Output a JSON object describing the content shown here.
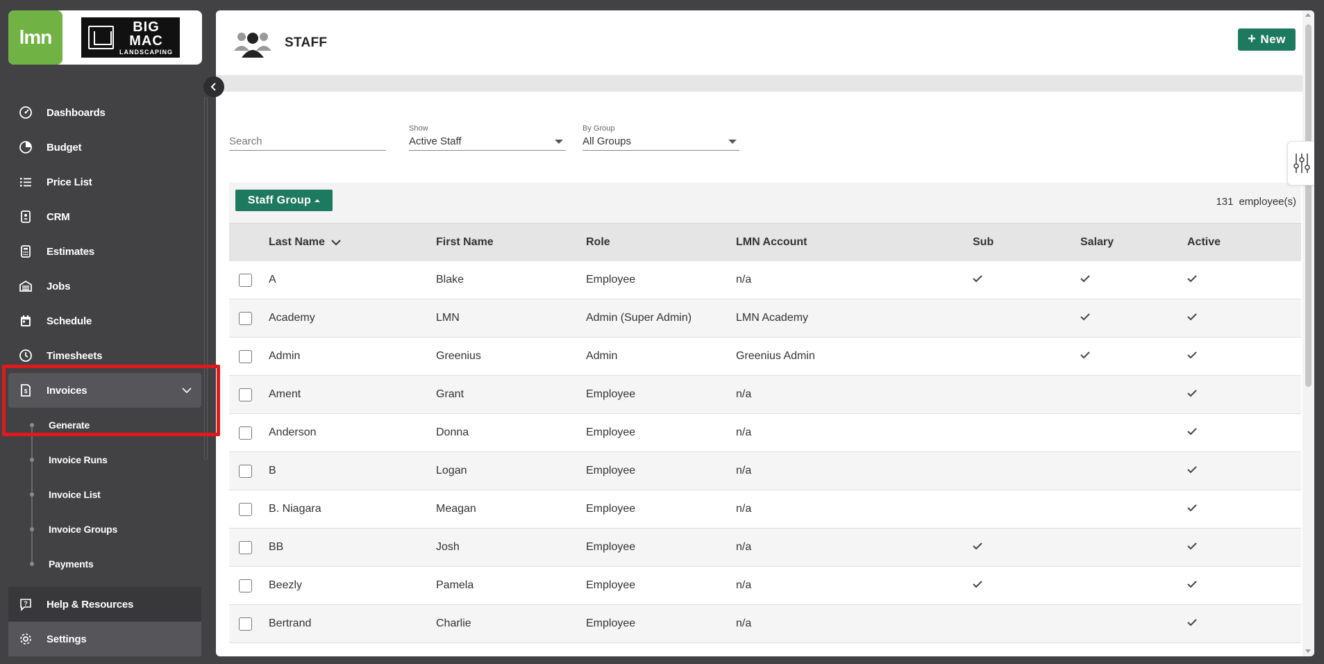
{
  "brand": {
    "lmn_logo": "lmn",
    "company_logo_line1": "BIG",
    "company_logo_line2": "MAC",
    "company_logo_line3": "LANDSCAPING"
  },
  "sidebar": {
    "items": [
      {
        "label": "Dashboards",
        "icon": "dashboard-icon"
      },
      {
        "label": "Budget",
        "icon": "pie-chart-icon"
      },
      {
        "label": "Price List",
        "icon": "list-icon"
      },
      {
        "label": "CRM",
        "icon": "contact-card-icon"
      },
      {
        "label": "Estimates",
        "icon": "calculator-icon"
      },
      {
        "label": "Jobs",
        "icon": "building-icon"
      },
      {
        "label": "Schedule",
        "icon": "calendar-icon"
      },
      {
        "label": "Timesheets",
        "icon": "clock-icon"
      },
      {
        "label": "Invoices",
        "icon": "invoice-icon"
      }
    ],
    "invoices_sub": [
      "Generate",
      "Invoice Runs",
      "Invoice List",
      "Invoice Groups",
      "Payments"
    ],
    "bottom": [
      {
        "label": "Help & Resources",
        "icon": "help-icon"
      },
      {
        "label": "Settings",
        "icon": "gear-icon"
      }
    ]
  },
  "header": {
    "title": "STAFF",
    "new_button": "New"
  },
  "filters": {
    "search_placeholder": "Search",
    "show_label": "Show",
    "show_value": "Active Staff",
    "group_label": "By Group",
    "group_value": "All Groups"
  },
  "table": {
    "group_button": "Staff Group",
    "employee_count": "131",
    "employee_count_suffix": "employee(s)",
    "columns": [
      "Last Name",
      "First Name",
      "Role",
      "LMN Account",
      "Sub",
      "Salary",
      "Active"
    ],
    "rows": [
      {
        "last": "A",
        "first": "Blake",
        "role": "Employee",
        "account": "n/a",
        "sub": true,
        "salary": true,
        "active": true
      },
      {
        "last": "Academy",
        "first": "LMN",
        "role": "Admin (Super Admin)",
        "account": "LMN Academy",
        "sub": false,
        "salary": true,
        "active": true
      },
      {
        "last": "Admin",
        "first": "Greenius",
        "role": "Admin",
        "account": "Greenius Admin",
        "sub": false,
        "salary": true,
        "active": true
      },
      {
        "last": "Ament",
        "first": "Grant",
        "role": "Employee",
        "account": "n/a",
        "sub": false,
        "salary": false,
        "active": true
      },
      {
        "last": "Anderson",
        "first": "Donna",
        "role": "Employee",
        "account": "n/a",
        "sub": false,
        "salary": false,
        "active": true
      },
      {
        "last": "B",
        "first": "Logan",
        "role": "Employee",
        "account": "n/a",
        "sub": false,
        "salary": false,
        "active": true
      },
      {
        "last": "B. Niagara",
        "first": "Meagan",
        "role": "Employee",
        "account": "n/a",
        "sub": false,
        "salary": false,
        "active": true
      },
      {
        "last": "BB",
        "first": "Josh",
        "role": "Employee",
        "account": "n/a",
        "sub": true,
        "salary": false,
        "active": true
      },
      {
        "last": "Beezly",
        "first": "Pamela",
        "role": "Employee",
        "account": "n/a",
        "sub": true,
        "salary": false,
        "active": true
      },
      {
        "last": "Bertrand",
        "first": "Charlie",
        "role": "Employee",
        "account": "n/a",
        "sub": false,
        "salary": false,
        "active": true
      }
    ]
  },
  "colors": {
    "sidebar_bg": "#424245",
    "accent_green": "#1e7a5e",
    "lmn_green": "#70b244",
    "highlight_red": "#e0191c"
  }
}
